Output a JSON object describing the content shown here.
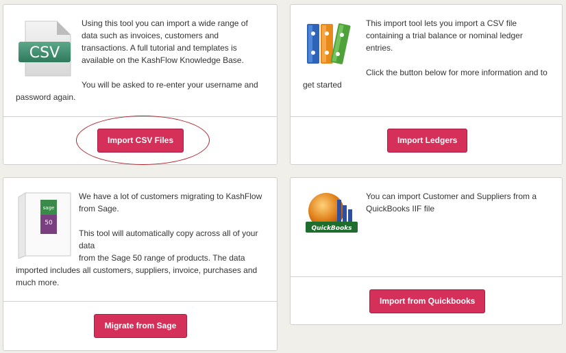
{
  "colors": {
    "background": "#f0efe9",
    "button": "#d4305a",
    "annotation_circle": "#b3202a"
  },
  "csv_card": {
    "icon": "csv-file-icon",
    "icon_label": "CSV",
    "text": [
      "Using this tool you can import a wide range of data such as invoices, customers and transactions. A full tutorial and templates is available on the KashFlow Knowledge Base.",
      "You will be asked to re-enter your username and password again."
    ],
    "button_label": "Import CSV Files"
  },
  "ledger_card": {
    "icon": "binders-icon",
    "text": [
      "This import tool lets you import a CSV file containing a trial balance or nominal ledger entries.",
      "Click the button below for more information and to get started"
    ],
    "button_label": "Import Ledgers"
  },
  "sage_card": {
    "icon": "sage-50-box-icon",
    "icon_label": "sage",
    "icon_number": "50",
    "text": [
      "We have a lot of customers migrating to KashFlow from Sage.",
      "This tool will automatically copy across all of your data",
      "from the Sage 50 range of products. The data imported includes all customers, suppliers, invoice, purchases and much more."
    ],
    "button_label": "Migrate from Sage"
  },
  "quickbooks_card": {
    "icon": "quickbooks-logo-icon",
    "icon_label": "QuickBooks",
    "text": [
      "You can import Customer and Suppliers from a QuickBooks IIF file"
    ],
    "button_label": "Import from Quickbooks"
  }
}
